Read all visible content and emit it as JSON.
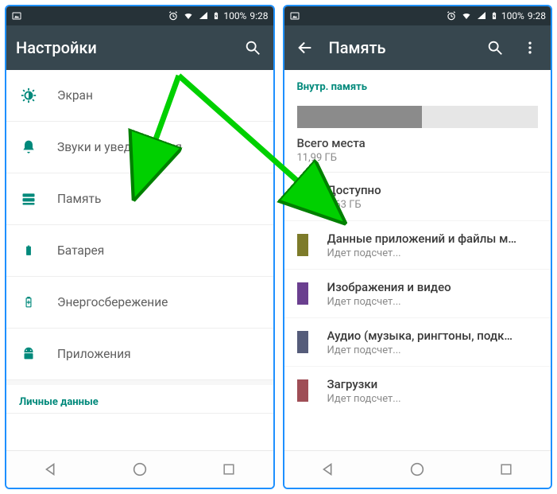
{
  "status": {
    "battery": "100%",
    "time": "9:28"
  },
  "left": {
    "title": "Настройки",
    "items": [
      {
        "label": "Экран"
      },
      {
        "label": "Звуки и уведомления"
      },
      {
        "label": "Память"
      },
      {
        "label": "Батарея"
      },
      {
        "label": "Энергосбережение"
      },
      {
        "label": "Приложения"
      }
    ],
    "personal_section": "Личные данные"
  },
  "right": {
    "title": "Память",
    "section": "Внутр. память",
    "total_label": "Всего места",
    "total_value": "11,99 ГБ",
    "used_fraction": 0.52,
    "categories": [
      {
        "title": "Доступно",
        "sub": "6,63 ГБ",
        "color": "#e6e6e6"
      },
      {
        "title": "Данные приложений и файлы мул.",
        "sub": "Идет подсчет...",
        "color": "#7d7b2a"
      },
      {
        "title": "Изображения и видео",
        "sub": "Идет подсчет...",
        "color": "#6a3f8f"
      },
      {
        "title": "Аудио (музыка, рингтоны, подкаст.",
        "sub": "Идет подсчет...",
        "color": "#555c7a"
      },
      {
        "title": "Загрузки",
        "sub": "Идет подсчет...",
        "color": "#9f4e56"
      }
    ]
  }
}
